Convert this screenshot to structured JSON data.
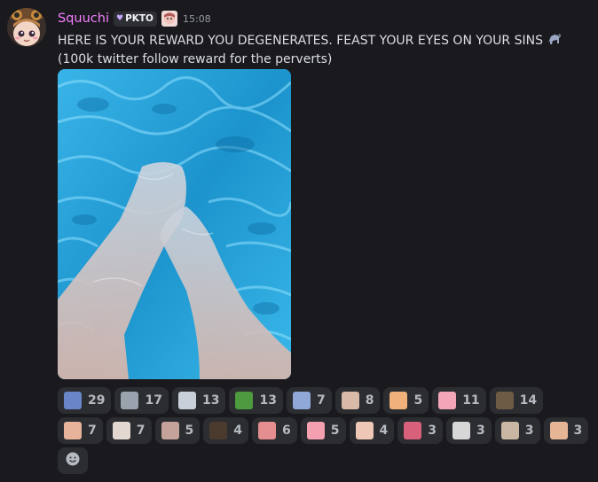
{
  "message": {
    "username": "Squuchi",
    "tag": "PKTO",
    "timestamp": "15:08",
    "line1": "HERE IS YOUR REWARD YOU DEGENERATES. FEAST YOUR EYES ON YOUR SINS",
    "line2": "(100k twitter follow reward for the perverts)"
  },
  "reactions": [
    {
      "emoji": "custom-emoji-ninja",
      "count": "29",
      "color": "#6b86c8"
    },
    {
      "emoji": "custom-emoji-cat",
      "count": "17",
      "color": "#9aa3ad"
    },
    {
      "emoji": "custom-emoji-glasses",
      "count": "13",
      "color": "#c9d0da"
    },
    {
      "emoji": "custom-emoji-pepe",
      "count": "13",
      "color": "#4d9a3f"
    },
    {
      "emoji": "custom-emoji-sword",
      "count": "7",
      "color": "#8fa8d8"
    },
    {
      "emoji": "custom-emoji-anime",
      "count": "8",
      "color": "#d9b9a7"
    },
    {
      "emoji": "custom-emoji-fox",
      "count": "5",
      "color": "#f0b27a"
    },
    {
      "emoji": "custom-emoji-pink",
      "count": "11",
      "color": "#f2a6b8"
    },
    {
      "emoji": "custom-emoji-dog",
      "count": "14",
      "color": "#6e5b45"
    },
    {
      "emoji": "custom-emoji-face-1",
      "count": "7",
      "color": "#e7b49b"
    },
    {
      "emoji": "custom-emoji-face-2",
      "count": "7",
      "color": "#e2d8d1"
    },
    {
      "emoji": "custom-emoji-face-3",
      "count": "5",
      "color": "#c6a39a"
    },
    {
      "emoji": "custom-emoji-hole",
      "count": "4",
      "color": "#4b3a2e"
    },
    {
      "emoji": "custom-emoji-tongue",
      "count": "6",
      "color": "#e58e8f"
    },
    {
      "emoji": "custom-emoji-lips",
      "count": "5",
      "color": "#f5a0b0"
    },
    {
      "emoji": "custom-emoji-face-4",
      "count": "4",
      "color": "#efc7b7"
    },
    {
      "emoji": "custom-emoji-girl",
      "count": "3",
      "color": "#d9607a"
    },
    {
      "emoji": "custom-emoji-cat-2",
      "count": "3",
      "color": "#d7d7d7"
    },
    {
      "emoji": "custom-emoji-cat-3",
      "count": "3",
      "color": "#c9b7a4"
    },
    {
      "emoji": "custom-emoji-cat-4",
      "count": "3",
      "color": "#e6b596"
    }
  ],
  "add_reaction_icon": "smiley-icon"
}
